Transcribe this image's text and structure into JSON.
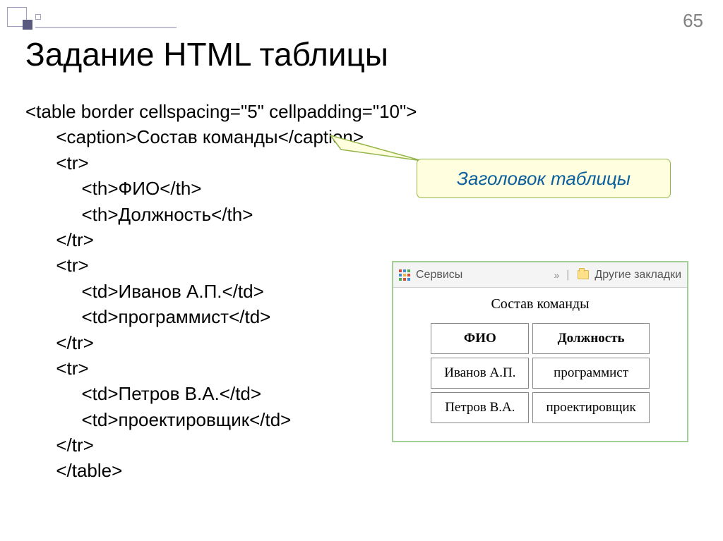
{
  "page_number": "65",
  "title": "Задание HTML таблицы",
  "code_lines": {
    "l1": "<table border cellspacing=\"5\" cellpadding=\"10\">",
    "l2": "      <caption>Состав команды</caption>",
    "l3": "      <tr>",
    "l4": "           <th>ФИО</th>",
    "l5": "           <th>Должность</th>",
    "l6": "      </tr>",
    "l7": "      <tr>",
    "l8": "           <td>Иванов А.П.</td>",
    "l9": "           <td>программист</td>",
    "l10": "      </tr>",
    "l11": "      <tr>",
    "l12": "           <td>Петров В.А.</td>",
    "l13": "           <td>проектировщик</td>",
    "l14": "      </tr>",
    "l15": "      </table>"
  },
  "callout": "Заголовок таблицы",
  "browser": {
    "services": "Сервисы",
    "chev": "»",
    "other_bookmarks": "Другие закладки"
  },
  "table": {
    "caption": "Состав команды",
    "headers": [
      "ФИО",
      "Должность"
    ],
    "rows": [
      [
        "Иванов А.П.",
        "программист"
      ],
      [
        "Петров В.А.",
        "проектировщик"
      ]
    ]
  }
}
